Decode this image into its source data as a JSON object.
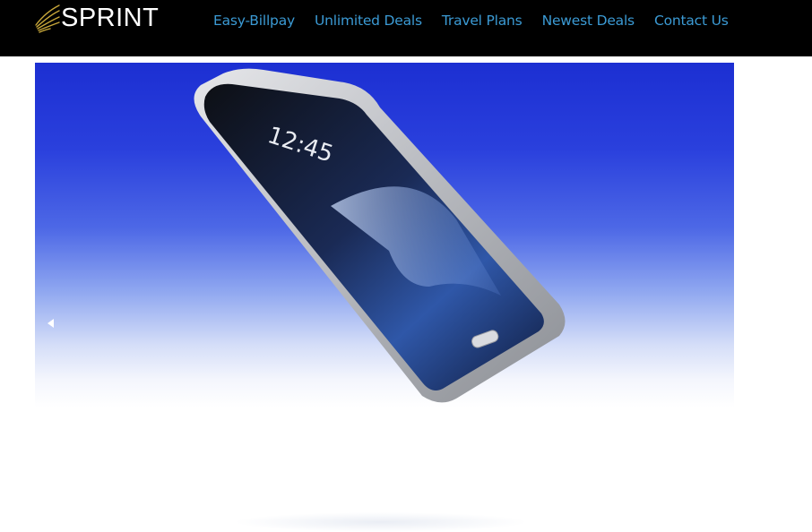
{
  "header": {
    "logo_text": "SPRINT",
    "logo_mark": "sprint-swoosh-icon",
    "nav": [
      {
        "label": "Easy-Billpay"
      },
      {
        "label": "Unlimited Deals"
      },
      {
        "label": "Travel Plans"
      },
      {
        "label": "Newest Deals"
      },
      {
        "label": "Contact Us"
      }
    ]
  },
  "slider": {
    "image": "samsung-galaxy-s7-edge-phone",
    "phone_time": "12:45",
    "prev_icon": "left-triangle-icon"
  },
  "colors": {
    "topbar": "#000000",
    "nav_link": "#3b9ad4",
    "logo_mark": "#c9a83a",
    "slide_bg": "#2a40dd"
  }
}
